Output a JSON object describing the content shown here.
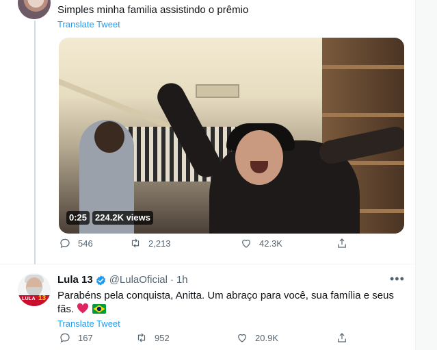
{
  "tweet1": {
    "text": "Simples minha familia assistindo o prêmio",
    "translate_label": "Translate Tweet",
    "video": {
      "duration": "0:25",
      "views": "224.2K views"
    },
    "stats": {
      "replies": "546",
      "retweets": "2,213",
      "likes": "42.3K"
    }
  },
  "tweet2": {
    "display_name": "Lula 13",
    "handle": "@LulaOficial",
    "separator": "·",
    "time": "1h",
    "text": "Parabéns pela conquista, Anitta. Um abraço para você, sua família e seus fãs.",
    "avatar": {
      "shirt_text": "LULA",
      "number": "13"
    },
    "translate_label": "Translate Tweet",
    "stats": {
      "replies": "167",
      "retweets": "952",
      "likes": "20.9K"
    }
  },
  "icons": [
    "reply-icon",
    "retweet-icon",
    "like-icon",
    "share-icon",
    "verified-badge-icon",
    "more-options-icon",
    "heart-emoji-icon",
    "brazil-flag-emoji-icon"
  ],
  "colors": {
    "accent": "#1d9bf0",
    "muted": "#536471",
    "text": "#0f1419",
    "heart": "#e0245e"
  }
}
